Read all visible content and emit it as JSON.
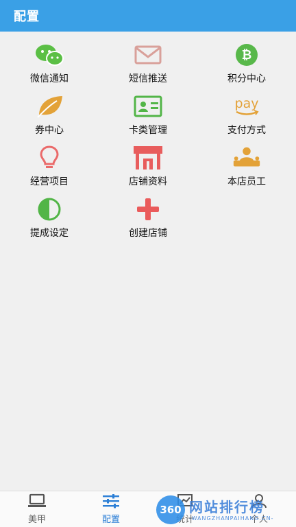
{
  "header": {
    "title": "配置"
  },
  "grid": {
    "items": [
      {
        "label": "微信通知",
        "icon": "wechat-icon",
        "color": "#5bbf45"
      },
      {
        "label": "短信推送",
        "icon": "envelope-icon",
        "color": "#d9a09a"
      },
      {
        "label": "积分中心",
        "icon": "bitcoin-icon",
        "color": "#58b84a"
      },
      {
        "label": "券中心",
        "icon": "leaf-icon",
        "color": "#e3a238"
      },
      {
        "label": "卡类管理",
        "icon": "id-card-icon",
        "color": "#52b547"
      },
      {
        "label": "支付方式",
        "icon": "amazon-pay-icon",
        "color": "#e3a238"
      },
      {
        "label": "经营项目",
        "icon": "lightbulb-icon",
        "color": "#ea6a6a"
      },
      {
        "label": "店铺资料",
        "icon": "store-icon",
        "color": "#e85d5d"
      },
      {
        "label": "本店员工",
        "icon": "staff-icon",
        "color": "#e3a238"
      },
      {
        "label": "提成设定",
        "icon": "half-circle-icon",
        "color": "#52b547"
      },
      {
        "label": "创建店铺",
        "icon": "plus-icon",
        "color": "#ea5b5b"
      }
    ]
  },
  "bottom_nav": {
    "items": [
      {
        "label": "美甲",
        "icon": "laptop-icon"
      },
      {
        "label": "配置",
        "icon": "sliders-icon",
        "active": true
      },
      {
        "label": "统计",
        "icon": "chart-icon"
      },
      {
        "label": "个人",
        "icon": "user-icon"
      }
    ]
  },
  "watermark": {
    "logo": "360",
    "main": "网站排行榜",
    "sub": "-WANGZHANPAIHANG.CN-"
  },
  "colors": {
    "accent": "#3aa0e6",
    "active_nav": "#2c7fd6"
  }
}
